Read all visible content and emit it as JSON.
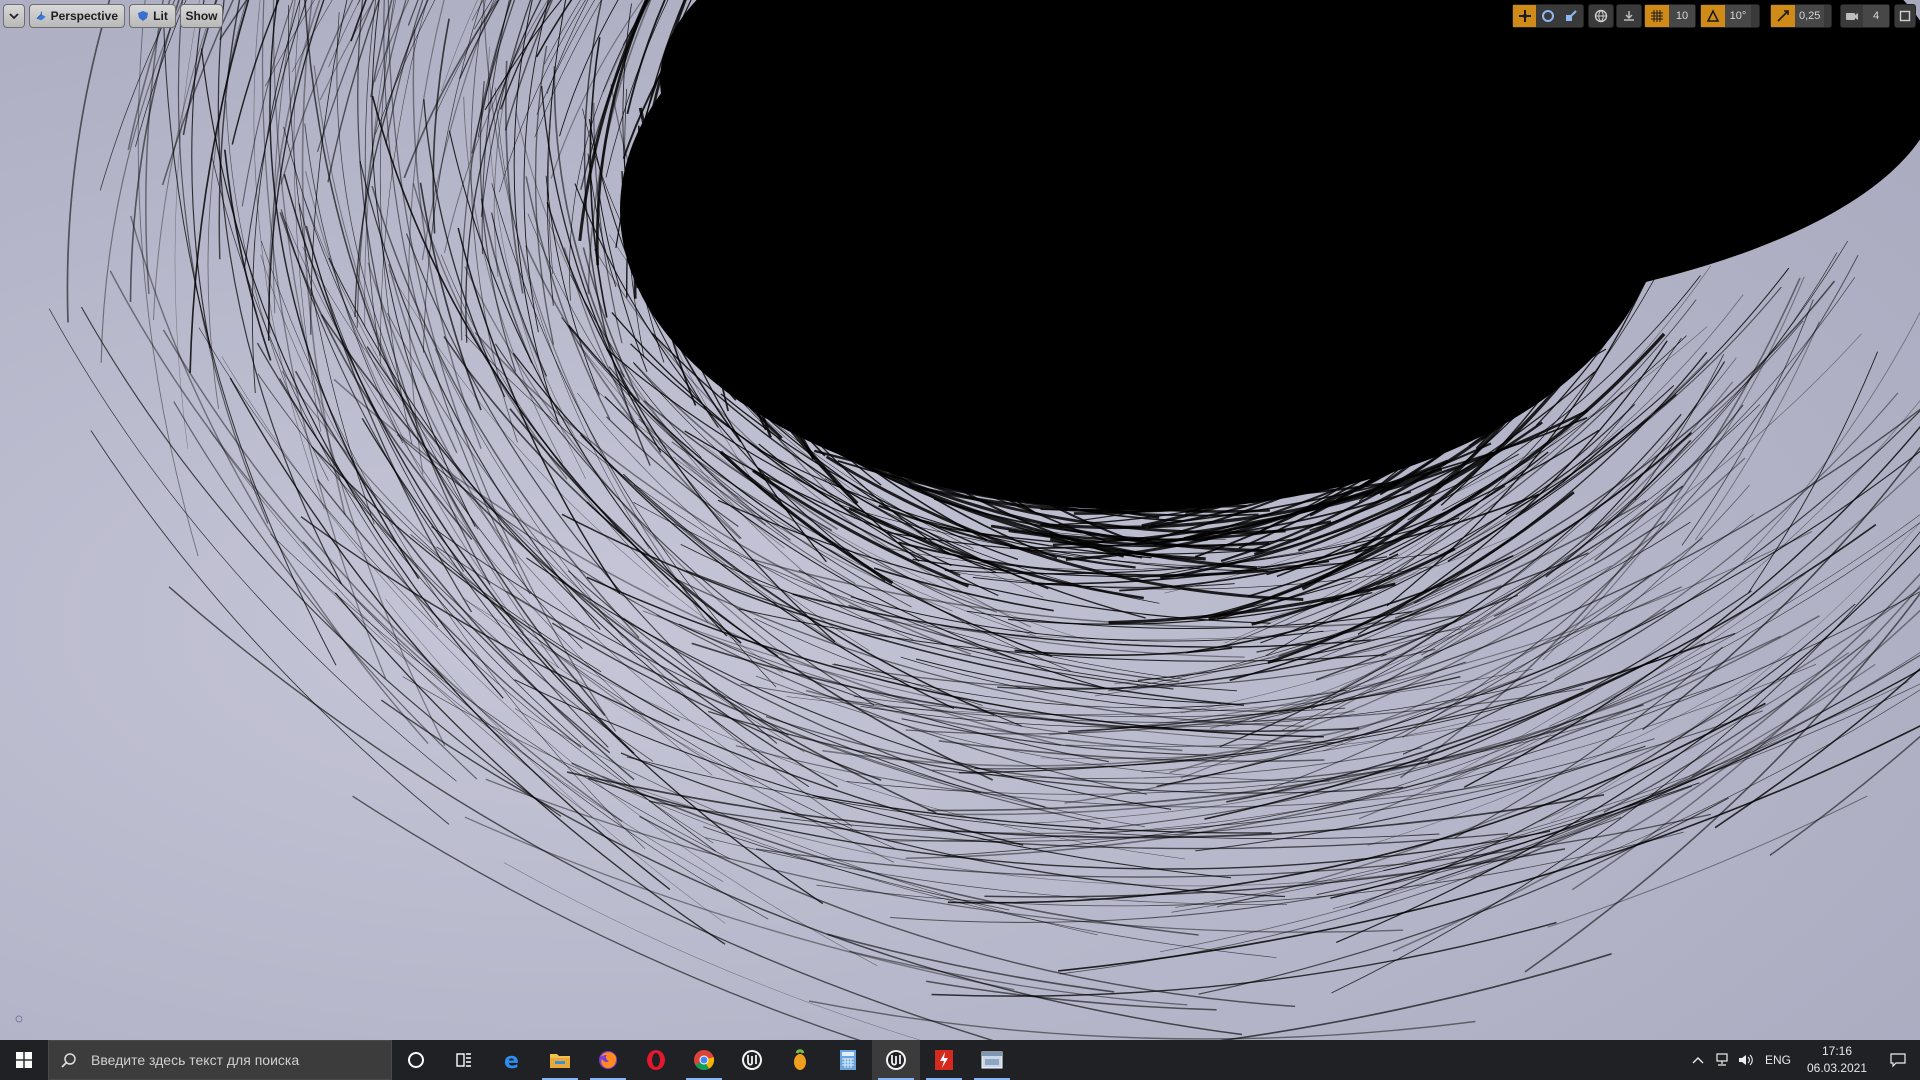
{
  "viewport": {
    "menu_icon": "chevron-down-icon",
    "perspective_label": "Perspective",
    "lit_label": "Lit",
    "show_label": "Show",
    "right_toolbar": {
      "grid_snap_value": "10",
      "rotation_snap_value": "10°",
      "scale_snap_value": "0,25",
      "camera_speed_value": "4"
    },
    "accent_color": "#d08a18"
  },
  "taskbar": {
    "search_placeholder": "Введите здесь текст для поиска",
    "apps": [
      {
        "name": "cortana-icon"
      },
      {
        "name": "task-view-icon"
      },
      {
        "name": "edge-icon"
      },
      {
        "name": "file-explorer-icon"
      },
      {
        "name": "firefox-icon"
      },
      {
        "name": "opera-icon"
      },
      {
        "name": "chrome-icon"
      },
      {
        "name": "unreal-engine-icon"
      },
      {
        "name": "fl-studio-icon"
      },
      {
        "name": "calculator-icon"
      },
      {
        "name": "unreal-editor-icon"
      },
      {
        "name": "flash-icon"
      },
      {
        "name": "app-window-icon"
      }
    ],
    "tray": {
      "language": "ENG",
      "time": "17:16",
      "date": "06.03.2021"
    }
  }
}
